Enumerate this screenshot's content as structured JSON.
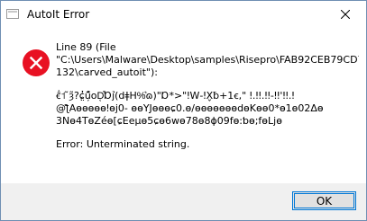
{
  "window": {
    "title": "AutoIt Error"
  },
  "message": {
    "line_number": "Line 89  (File",
    "file_line_1": "\"C:\\Users\\Malware\\Desktop\\samples\\Risepro\\FAB92CEB79CD7",
    "file_line_2": "132\\carved_autoit\"):",
    "garbled_line_1": "ꞓ̂͒˦ ̃ȝ͂?ɕ͏̤̓ũ̦̓͂oD͔͒Ɒj̉͘͘(dǂH%͛ɷ)\"Ɒ*>\"ǃW‑ǃX̬ƀ+1ꞓ,\"  ǃ.ǃǃ.ǃǃ‑ǃǃ'ǃǃ.ǃ",
    "garbled_line_2": "@ƪAɵɵɵɵɵǃɵj0‑  ɵɵYJɵɵɵɕ0.ɵ/ɵɵɵɵɵɵɵdɵKɵɵ0*ɵ1ɵ02Δɵ",
    "garbled_line_3": "3Nɵ4TɵZéɵ[ɕEeμɵ5ɕɵ6wɵ78ɵ8ɸ09fɵ:ƅɵ;fɵLjɵ",
    "error_text": "Error: Unterminated string."
  },
  "buttons": {
    "ok_label": "OK"
  },
  "icons": {
    "error": "error-icon",
    "close": "close-icon",
    "app": "app-window-icon"
  },
  "colors": {
    "error_red": "#e81123",
    "button_border": "#0078d7",
    "footer_bg": "#f0f0f0"
  }
}
